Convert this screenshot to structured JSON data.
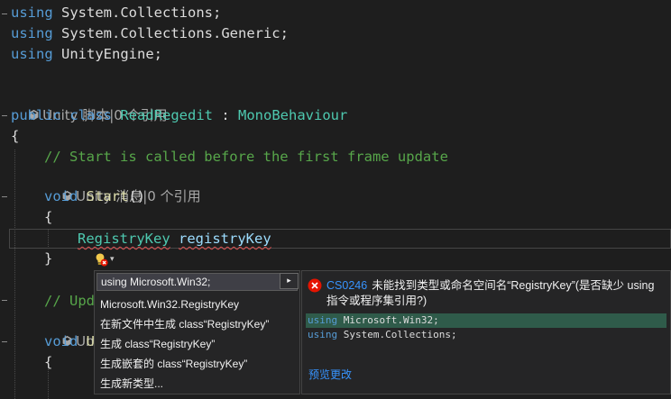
{
  "editor": {
    "usings": [
      {
        "keyword": "using",
        "name": "System.Collections;"
      },
      {
        "keyword": "using",
        "name": "System.Collections.Generic;"
      },
      {
        "keyword": "using",
        "name": "UnityEngine;"
      }
    ],
    "class_lens": "Unity 脚本|0 个引用",
    "class_decl": {
      "kw1": "public",
      "kw2": "class",
      "name": "ReadRegedit",
      "sep": " : ",
      "base": "MonoBehaviour"
    },
    "open_brace": "{",
    "close_brace": "}",
    "comment_start": "// Start is called before the first frame update",
    "method_lens": "Unity 消息|0 个引用",
    "start_decl": {
      "kw": "void",
      "name": "Start",
      "parens": "()"
    },
    "registry_line": {
      "type": "RegistryKey",
      "var": "registryKey"
    },
    "comment_update_partial": "// Upd",
    "update_lens_partial": "Unit",
    "update_decl_partial": {
      "kw": "void",
      "name": "U"
    }
  },
  "quick_actions": {
    "bulb_arrow": "▾",
    "first": "using Microsoft.Win32;",
    "items": [
      "Microsoft.Win32.RegistryKey",
      "在新文件中生成 class“RegistryKey”",
      "生成 class“RegistryKey”",
      "生成嵌套的 class“RegistryKey”",
      "生成新类型..."
    ],
    "expand_glyph": "▸"
  },
  "preview": {
    "code": "CS0246",
    "message": "未能找到类型或命名空间名“RegistryKey”(是否缺少 using 指令或程序集引用?)",
    "lines": [
      {
        "kw": "using",
        "rest": " Microsoft.Win32;"
      },
      {
        "kw": "using",
        "rest": " System.Collections;"
      }
    ],
    "preview_changes": "预览更改"
  },
  "colors": {
    "background": "#1e1e1e",
    "keyword": "#569cd6",
    "type": "#4ec9b0",
    "identifier": "#9cdcfe",
    "comment": "#57a64a",
    "error": "#e05252",
    "link": "#3794ff",
    "added_line": "#2f5b4a"
  }
}
